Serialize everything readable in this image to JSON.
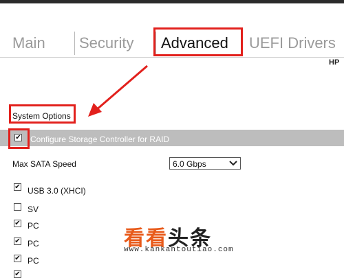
{
  "tabs": [
    {
      "label": "Main"
    },
    {
      "label": "Security"
    },
    {
      "label": "Advanced"
    },
    {
      "label": "UEFI Drivers"
    }
  ],
  "brand": "HP",
  "section": {
    "title": "System Options"
  },
  "options": {
    "raid": {
      "label": "Configure Storage Controller for RAID",
      "checked": true
    },
    "sata": {
      "label": "Max SATA Speed",
      "value": "6.0 Gbps"
    },
    "rows": [
      {
        "label": "USB 3.0 (XHCI)",
        "checked": true
      },
      {
        "label": "SV",
        "checked": false
      },
      {
        "label": "PC",
        "checked": true
      },
      {
        "label": "PC",
        "checked": true
      },
      {
        "label": "PC",
        "checked": true
      }
    ]
  },
  "watermark": {
    "text_orange": "看看",
    "text_dark": "头条",
    "url": "www.kankantoutiao.com"
  },
  "colors": {
    "highlight": "#e2201c",
    "watermark": "#e85a1a",
    "bar": "#bdbdbd"
  },
  "icons": {
    "checkbox": "check-mark",
    "dropdown": "chevron-down-icon",
    "annotation": "red-arrow"
  }
}
